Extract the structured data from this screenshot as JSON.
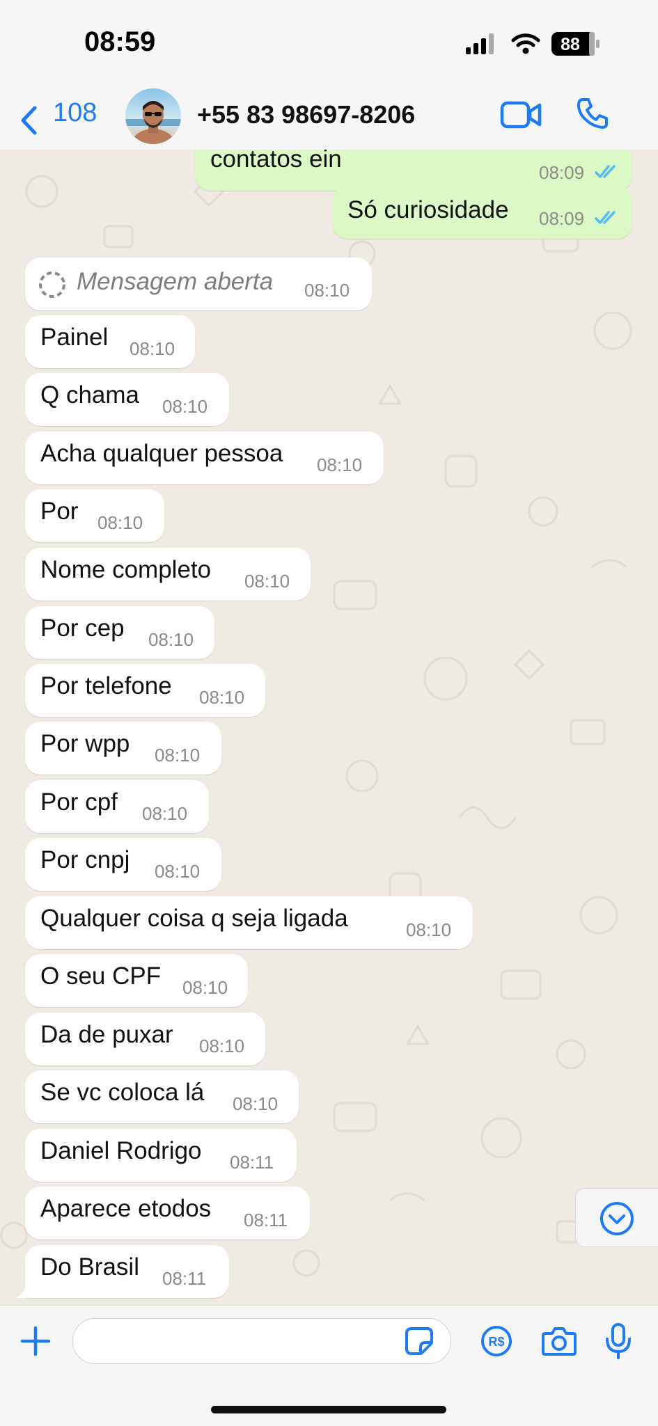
{
  "status_bar": {
    "time": "08:59",
    "battery": "88"
  },
  "header": {
    "back_count": "108",
    "contact_name": "+55 83 98697-8206"
  },
  "messages": [
    {
      "dir": "out",
      "text": "contatos ein",
      "time": "08:09",
      "ticks": "read"
    },
    {
      "dir": "out",
      "text": "Só curiosidade",
      "time": "08:09",
      "ticks": "read"
    },
    {
      "dir": "in",
      "text": "Mensagem aberta",
      "time": "08:10",
      "kind": "view-once-opened"
    },
    {
      "dir": "in",
      "text": "Painel",
      "time": "08:10"
    },
    {
      "dir": "in",
      "text": "Q chama",
      "time": "08:10"
    },
    {
      "dir": "in",
      "text": "Acha qualquer pessoa",
      "time": "08:10"
    },
    {
      "dir": "in",
      "text": "Por",
      "time": "08:10"
    },
    {
      "dir": "in",
      "text": "Nome completo",
      "time": "08:10"
    },
    {
      "dir": "in",
      "text": "Por cep",
      "time": "08:10"
    },
    {
      "dir": "in",
      "text": "Por telefone",
      "time": "08:10"
    },
    {
      "dir": "in",
      "text": "Por wpp",
      "time": "08:10"
    },
    {
      "dir": "in",
      "text": "Por cpf",
      "time": "08:10"
    },
    {
      "dir": "in",
      "text": "Por cnpj",
      "time": "08:10"
    },
    {
      "dir": "in",
      "text": "Qualquer coisa q seja ligada",
      "time": "08:10"
    },
    {
      "dir": "in",
      "text": "O seu CPF",
      "time": "08:10"
    },
    {
      "dir": "in",
      "text": "Da de puxar",
      "time": "08:10"
    },
    {
      "dir": "in",
      "text": "Se vc coloca lá",
      "time": "08:10"
    },
    {
      "dir": "in",
      "text": "Daniel Rodrigo",
      "time": "08:11"
    },
    {
      "dir": "in",
      "text": "Aparece etodos",
      "time": "08:11"
    },
    {
      "dir": "in",
      "text": "Do Brasil",
      "time": "08:11"
    }
  ],
  "composer": {
    "input_value": "",
    "currency_label": "R$"
  },
  "icons": {
    "back": "chevron-left-icon",
    "video": "video-call-icon",
    "call": "phone-icon",
    "attach": "plus-icon",
    "sticker": "sticker-icon",
    "pay": "payment-icon",
    "camera": "camera-icon",
    "mic": "microphone-icon",
    "scroll_down": "chevron-down-icon"
  },
  "colors": {
    "accent": "#1e7bf2",
    "read_ticks": "#53bdeb",
    "outgoing_bubble": "#dcf8c6",
    "incoming_bubble": "#ffffff",
    "chat_background": "#efeae2",
    "bar_background": "#f6f6f6"
  }
}
